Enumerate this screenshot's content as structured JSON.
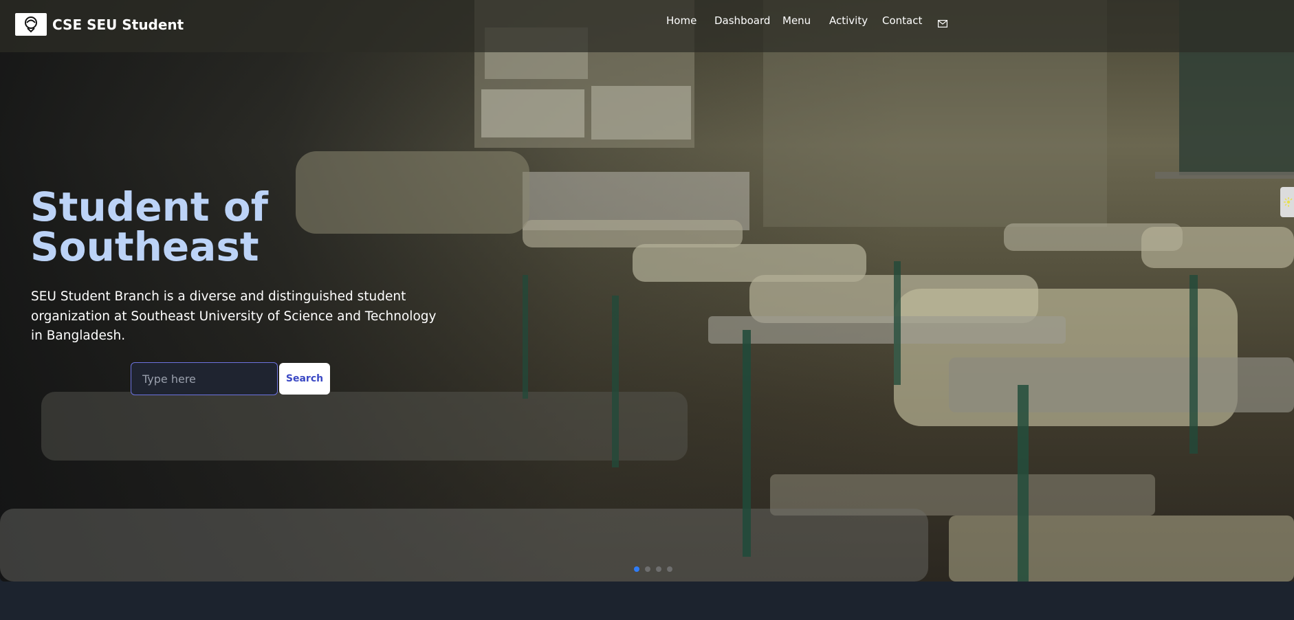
{
  "navbar": {
    "brand": "CSE SEU Student",
    "links": [
      "Home",
      "Dashboard",
      "Menu",
      "Activity",
      "Contact"
    ],
    "mail_icon": "mail-icon",
    "logo_icon": "seu-logo-icon"
  },
  "hero": {
    "title_line1": "Student of",
    "title_line2": "Southeast",
    "description": "SEU Student Branch is a diverse and distinguished student organization at Southeast University of Science and Technology in Bangladesh.",
    "search_placeholder": "Type here",
    "search_button": "Search",
    "carousel_slide_count": 4,
    "carousel_active_index": 0
  },
  "colors": {
    "title": "#bcd3f7",
    "input_border": "#6d73e0",
    "button_text": "#3a48c4",
    "active_dot": "#2f7cf6",
    "page_bg": "#1c232e"
  }
}
